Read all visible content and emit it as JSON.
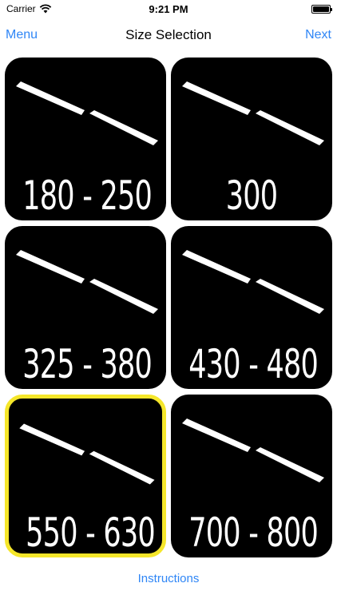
{
  "status_bar": {
    "carrier": "Carrier",
    "time": "9:21 PM",
    "wifi_icon": "wifi-icon",
    "battery_icon": "battery-icon"
  },
  "nav": {
    "left_label": "Menu",
    "title": "Size Selection",
    "right_label": "Next"
  },
  "tiles": [
    {
      "label": "180 - 250",
      "selected": false
    },
    {
      "label": "300",
      "selected": false
    },
    {
      "label": "325 - 380",
      "selected": false
    },
    {
      "label": "430 - 480",
      "selected": false
    },
    {
      "label": "550 - 630",
      "selected": true
    },
    {
      "label": "700 - 800",
      "selected": false
    }
  ],
  "footer": {
    "instructions_label": "Instructions"
  },
  "colors": {
    "accent": "#2f86f6",
    "tile_bg": "#000000",
    "selected_border": "#f5e62a"
  }
}
